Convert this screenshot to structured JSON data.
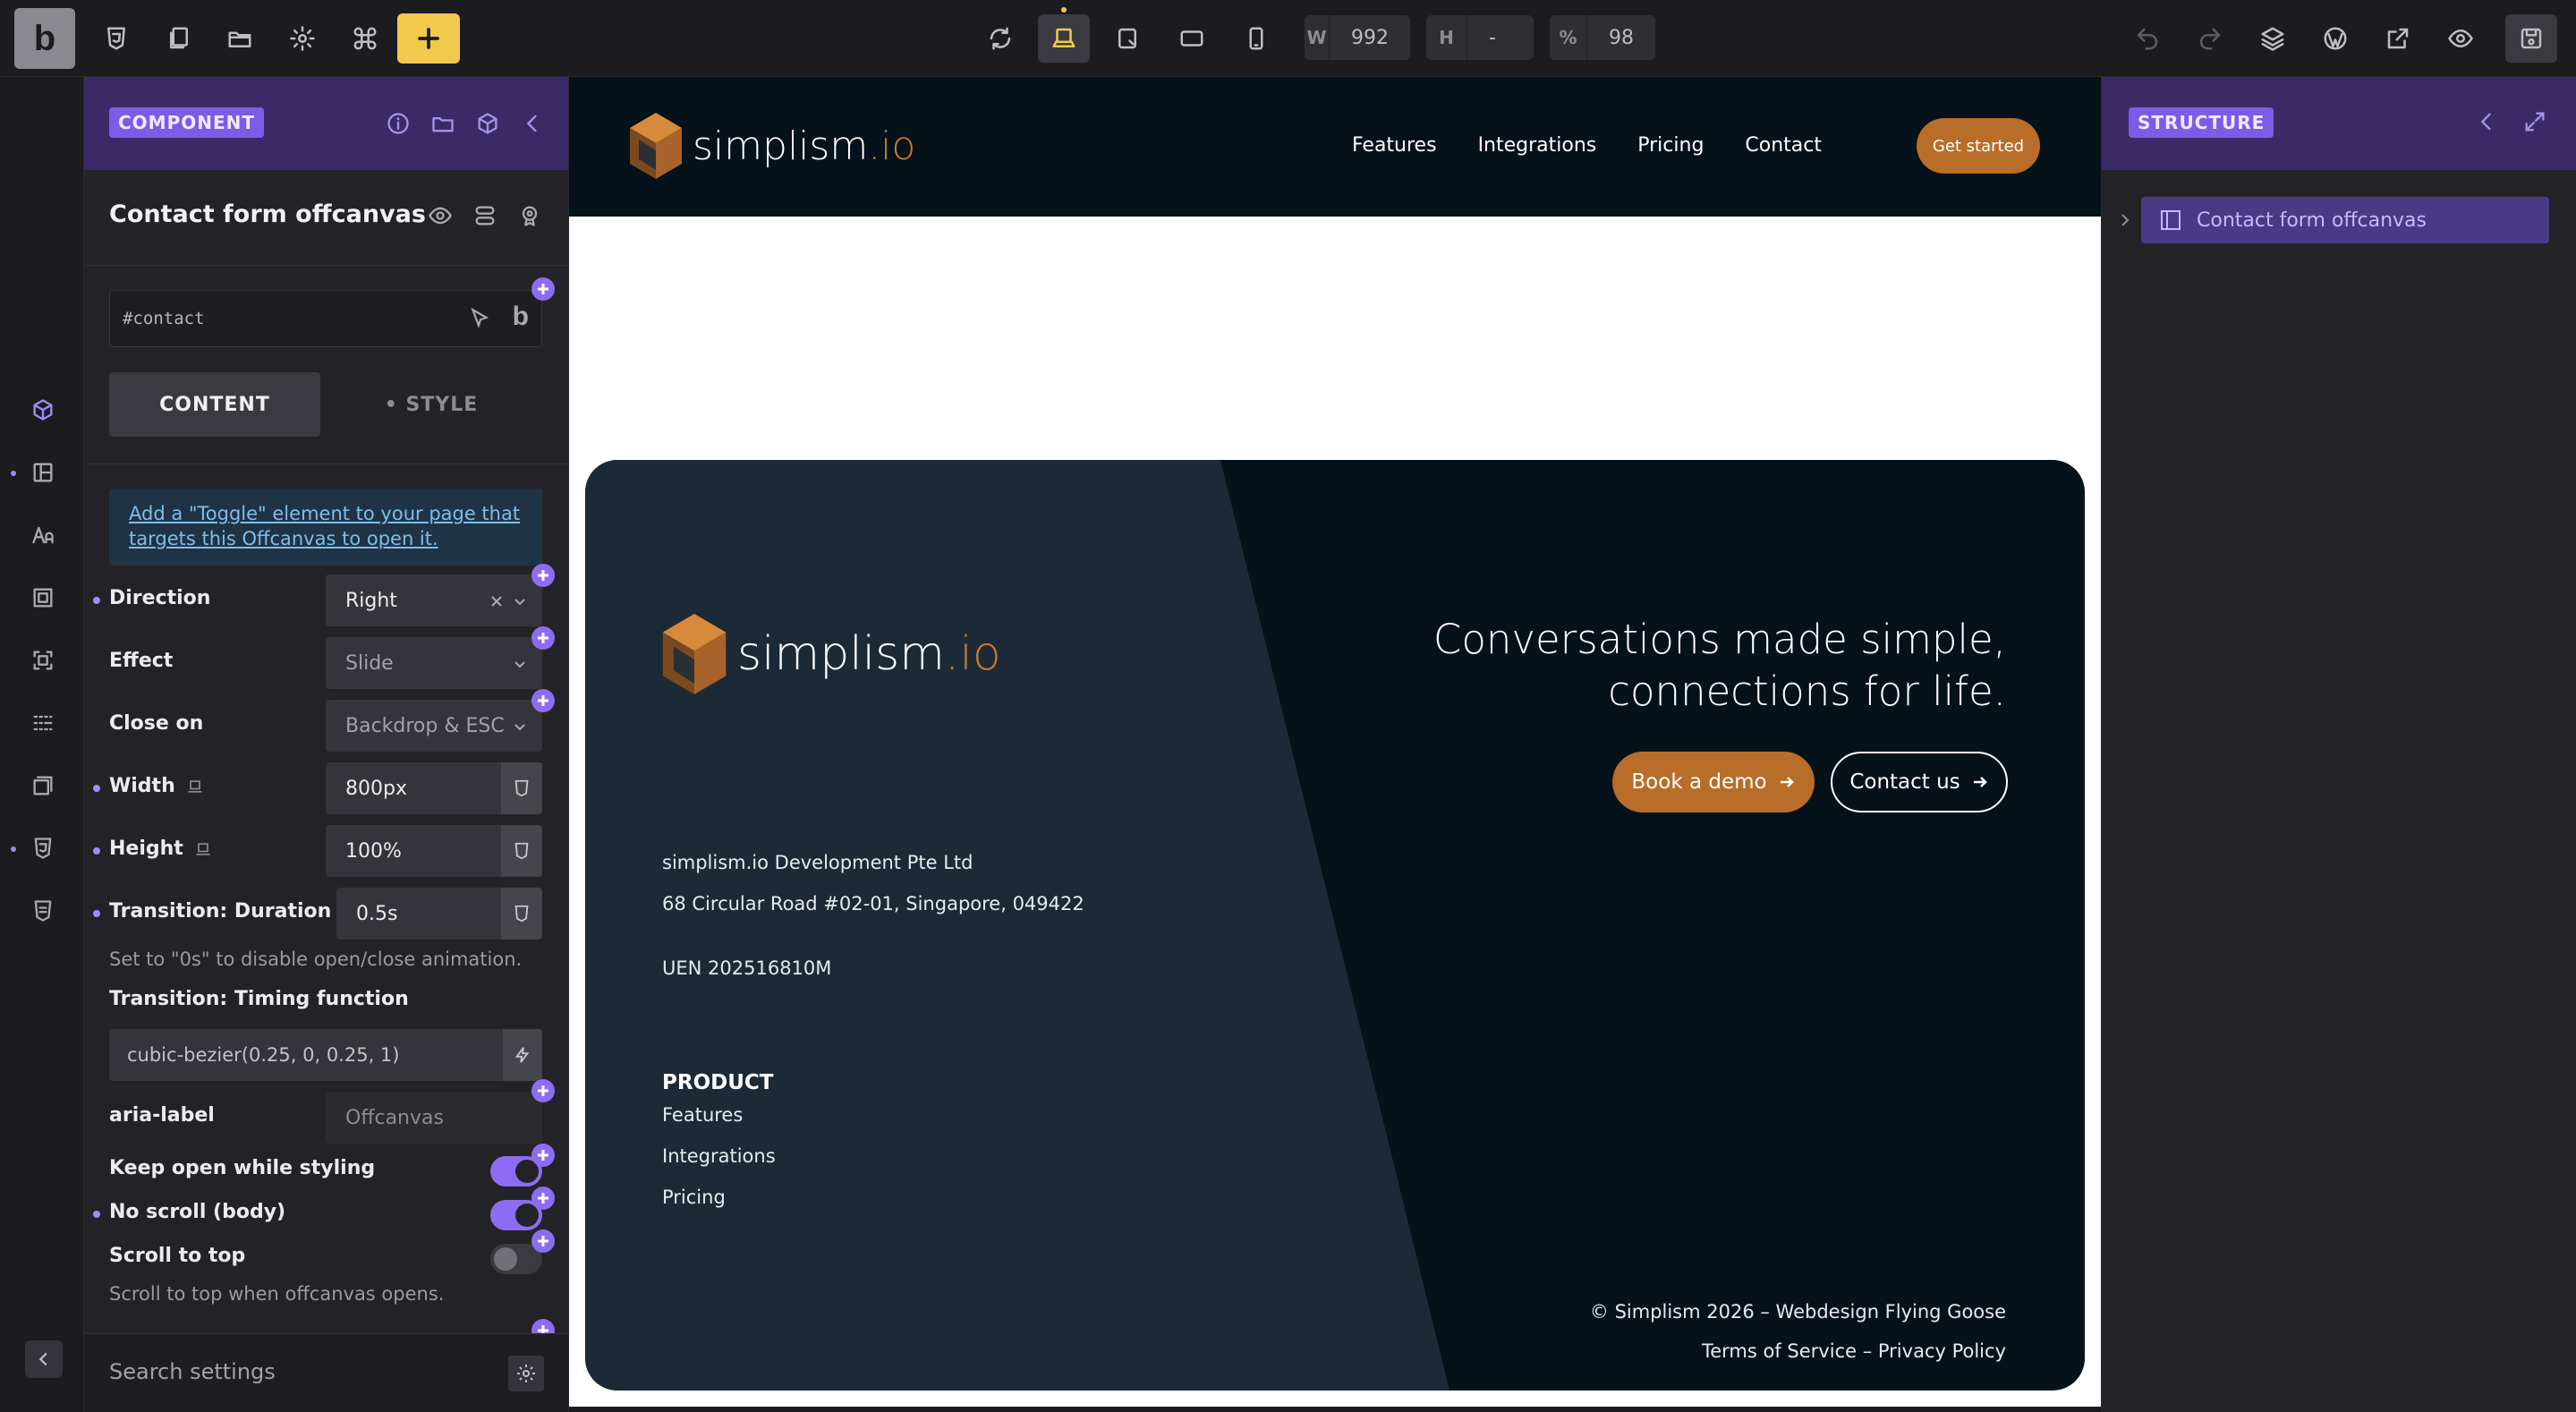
{
  "toolbar": {
    "logo": "b",
    "width_label": "W",
    "width_value": "992",
    "height_label": "H",
    "height_value": "-",
    "zoom_label": "%",
    "zoom_value": "98"
  },
  "panel": {
    "badge": "COMPONENT",
    "title": "Contact form offcanvas",
    "id_value": "#contact",
    "id_button": "b",
    "tabs": {
      "content": "CONTENT",
      "style": "• STYLE"
    },
    "info": "Add a \"Toggle\" element to your page that targets this Offcanvas to open it.",
    "fields": {
      "direction": {
        "label": "Direction",
        "value": "Right"
      },
      "effect": {
        "label": "Effect",
        "value": "Slide"
      },
      "close_on": {
        "label": "Close on",
        "value": "Backdrop & ESC"
      },
      "width": {
        "label": "Width",
        "value": "800px"
      },
      "height": {
        "label": "Height",
        "value": "100%"
      },
      "duration": {
        "label": "Transition: Duration",
        "value": "0.5s",
        "hint": "Set to \"0s\" to disable open/close animation."
      },
      "timing": {
        "label": "Transition: Timing function",
        "placeholder": "cubic-bezier(0.25, 0, 0.25, 1)"
      },
      "aria": {
        "label": "aria-label",
        "placeholder": "Offcanvas"
      },
      "keep_open": {
        "label": "Keep open while styling",
        "on": true
      },
      "no_scroll": {
        "label": "No scroll (body)",
        "on": true
      },
      "scroll_top": {
        "label": "Scroll to top",
        "on": false,
        "hint": "Scroll to top when offcanvas opens."
      }
    },
    "search_placeholder": "Search settings"
  },
  "site": {
    "brand": "simplism",
    "brand_tld": ".io",
    "nav": [
      "Features",
      "Integrations",
      "Pricing",
      "Contact"
    ],
    "cta": "Get started",
    "footer": {
      "tagline_1": "Conversations made simple,",
      "tagline_2": "connections for life.",
      "btn_demo": "Book a demo",
      "btn_contact": "Contact us",
      "company": "simplism.io Development Pte Ltd",
      "address": "68 Circular Road #02-01, Singapore, 049422",
      "uen": "UEN 202516810M",
      "product_head": "PRODUCT",
      "product_links": [
        "Features",
        "Integrations",
        "Pricing"
      ],
      "copyright": "© Simplism 2026 – Webdesign Flying Goose",
      "legal": "Terms of Service – Privacy Policy"
    }
  },
  "structure": {
    "badge": "STRUCTURE",
    "items": [
      "Contact form offcanvas"
    ]
  },
  "colors": {
    "accent": "#8c6cf0",
    "brand_orange": "#b86d28",
    "brand_dark": "#05121a",
    "toolbar_yellow": "#f2c94c"
  }
}
